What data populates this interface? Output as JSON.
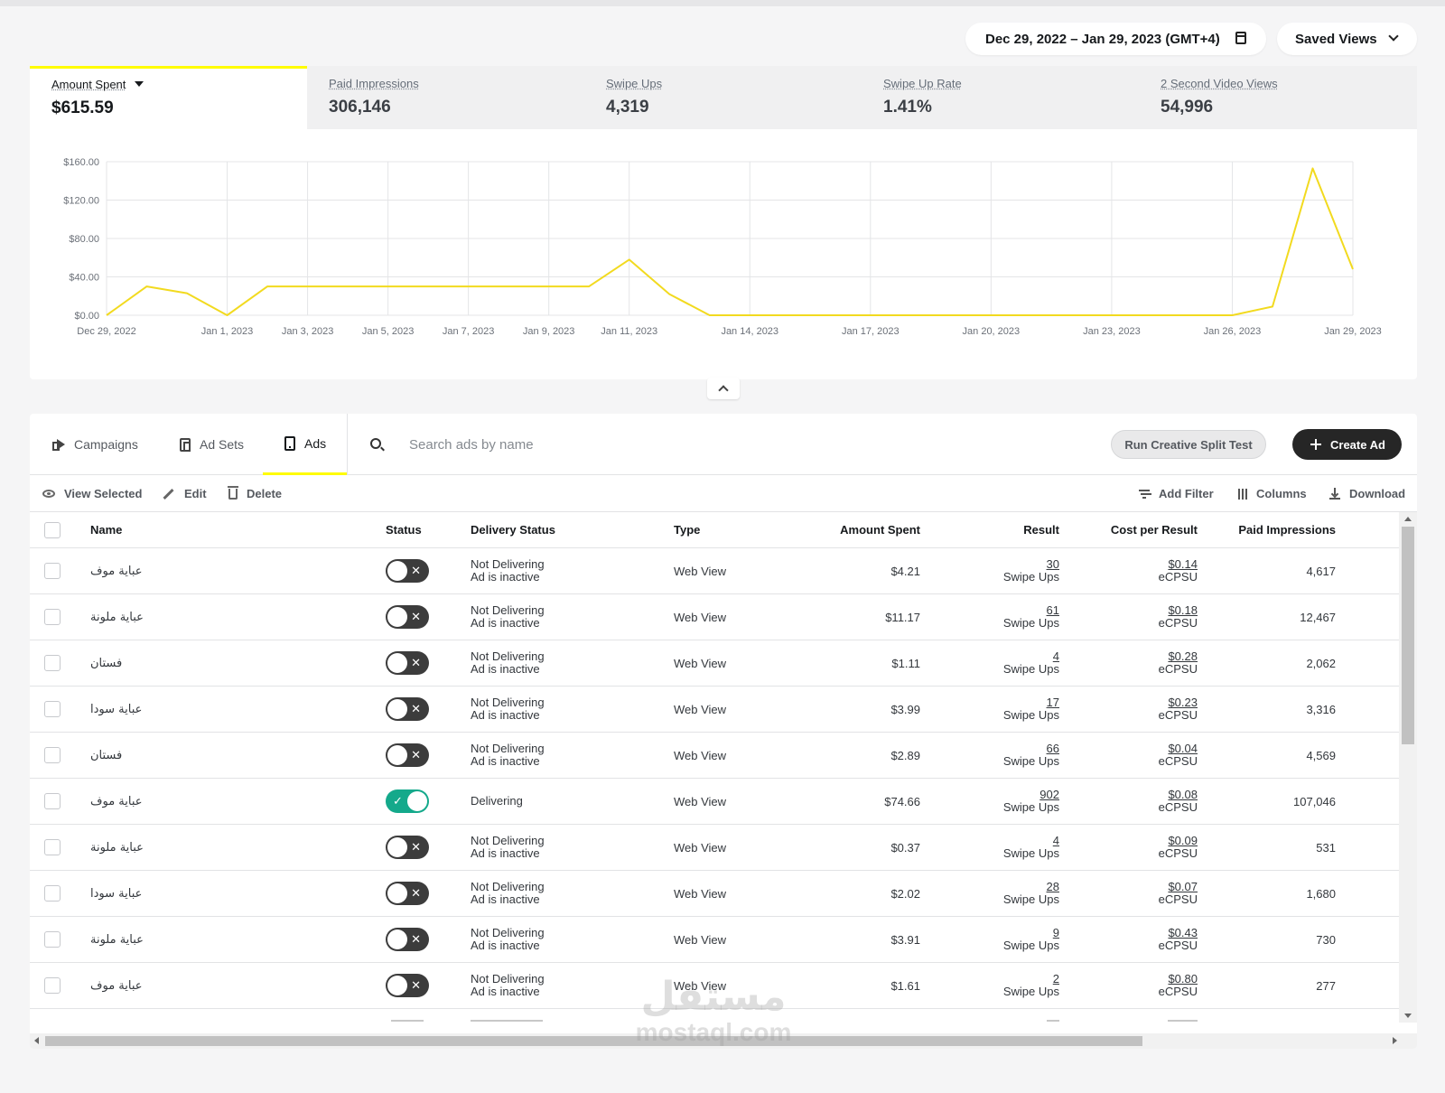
{
  "header": {
    "date_range": "Dec 29, 2022 – Jan 29, 2023 (GMT+4)",
    "saved_views": "Saved Views"
  },
  "metrics": [
    {
      "label": "Amount Spent",
      "value": "$615.59",
      "active": true
    },
    {
      "label": "Paid Impressions",
      "value": "306,146",
      "active": false
    },
    {
      "label": "Swipe Ups",
      "value": "4,319",
      "active": false
    },
    {
      "label": "Swipe Up Rate",
      "value": "1.41%",
      "active": false
    },
    {
      "label": "2 Second Video Views",
      "value": "54,996",
      "active": false
    }
  ],
  "chart_data": {
    "type": "line",
    "series": [
      {
        "values": [
          0,
          30,
          23,
          0,
          30,
          30,
          30,
          30,
          30,
          30,
          30,
          30,
          30,
          58,
          22,
          0,
          0,
          0,
          0,
          0,
          0,
          0,
          0,
          0,
          0,
          0,
          0,
          0,
          0,
          9,
          153,
          48
        ],
        "color": "#f2da1f"
      }
    ],
    "x": [
      "2022-12-29",
      "2022-12-30",
      "2022-12-31",
      "2023-01-01",
      "2023-01-02",
      "2023-01-03",
      "2023-01-04",
      "2023-01-05",
      "2023-01-06",
      "2023-01-07",
      "2023-01-08",
      "2023-01-09",
      "2023-01-10",
      "2023-01-11",
      "2023-01-12",
      "2023-01-13",
      "2023-01-14",
      "2023-01-15",
      "2023-01-16",
      "2023-01-17",
      "2023-01-18",
      "2023-01-19",
      "2023-01-20",
      "2023-01-21",
      "2023-01-22",
      "2023-01-23",
      "2023-01-24",
      "2023-01-25",
      "2023-01-26",
      "2023-01-27",
      "2023-01-28",
      "2023-01-29"
    ],
    "x_tick_labels": [
      {
        "date": "2022-12-29",
        "label": "Dec 29, 2022"
      },
      {
        "date": "2023-01-01",
        "label": "Jan 1, 2023"
      },
      {
        "date": "2023-01-03",
        "label": "Jan 3, 2023"
      },
      {
        "date": "2023-01-05",
        "label": "Jan 5, 2023"
      },
      {
        "date": "2023-01-07",
        "label": "Jan 7, 2023"
      },
      {
        "date": "2023-01-09",
        "label": "Jan 9, 2023"
      },
      {
        "date": "2023-01-11",
        "label": "Jan 11, 2023"
      },
      {
        "date": "2023-01-14",
        "label": "Jan 14, 2023"
      },
      {
        "date": "2023-01-17",
        "label": "Jan 17, 2023"
      },
      {
        "date": "2023-01-20",
        "label": "Jan 20, 2023"
      },
      {
        "date": "2023-01-23",
        "label": "Jan 23, 2023"
      },
      {
        "date": "2023-01-26",
        "label": "Jan 26, 2023"
      },
      {
        "date": "2023-01-29",
        "label": "Jan 29, 2023"
      }
    ],
    "y_ticks": [
      0,
      40,
      80,
      120,
      160
    ],
    "y_tick_labels": [
      "$0.00",
      "$40.00",
      "$80.00",
      "$120.00",
      "$160.00"
    ],
    "ylim": [
      0,
      160
    ],
    "grid": true
  },
  "tabs": [
    {
      "label": "Campaigns",
      "icon": "megaphone-icon",
      "active": false
    },
    {
      "label": "Ad Sets",
      "icon": "adsets-icon",
      "active": false
    },
    {
      "label": "Ads",
      "icon": "ad-icon",
      "active": true
    }
  ],
  "search": {
    "placeholder": "Search ads by name",
    "value": ""
  },
  "buttons": {
    "split_test": "Run Creative Split Test",
    "create_ad": "Create Ad"
  },
  "actions": {
    "view_selected": "View Selected",
    "edit": "Edit",
    "delete": "Delete",
    "add_filter": "Add Filter",
    "columns": "Columns",
    "download": "Download"
  },
  "table": {
    "columns": [
      "Name",
      "Status",
      "Delivery Status",
      "Type",
      "Amount Spent",
      "Result",
      "Cost per Result",
      "Paid Impressions"
    ],
    "result_unit": "Swipe Ups",
    "cost_unit": "eCPSU",
    "rows": [
      {
        "name": "عباية موف",
        "active": false,
        "delivery": "Not Delivering",
        "delivery_sub": "Ad is inactive",
        "type": "Web View",
        "spent": "$4.21",
        "result": "30",
        "cost": "$0.14",
        "impressions": "4,617"
      },
      {
        "name": "عباية ملونة",
        "active": false,
        "delivery": "Not Delivering",
        "delivery_sub": "Ad is inactive",
        "type": "Web View",
        "spent": "$11.17",
        "result": "61",
        "cost": "$0.18",
        "impressions": "12,467"
      },
      {
        "name": "فستان",
        "active": false,
        "delivery": "Not Delivering",
        "delivery_sub": "Ad is inactive",
        "type": "Web View",
        "spent": "$1.11",
        "result": "4",
        "cost": "$0.28",
        "impressions": "2,062"
      },
      {
        "name": "عباية سودا",
        "active": false,
        "delivery": "Not Delivering",
        "delivery_sub": "Ad is inactive",
        "type": "Web View",
        "spent": "$3.99",
        "result": "17",
        "cost": "$0.23",
        "impressions": "3,316"
      },
      {
        "name": "فستان",
        "active": false,
        "delivery": "Not Delivering",
        "delivery_sub": "Ad is inactive",
        "type": "Web View",
        "spent": "$2.89",
        "result": "66",
        "cost": "$0.04",
        "impressions": "4,569"
      },
      {
        "name": "عباية موف",
        "active": true,
        "delivery": "Delivering",
        "delivery_sub": "",
        "type": "Web View",
        "spent": "$74.66",
        "result": "902",
        "cost": "$0.08",
        "impressions": "107,046"
      },
      {
        "name": "عباية ملونة",
        "active": false,
        "delivery": "Not Delivering",
        "delivery_sub": "Ad is inactive",
        "type": "Web View",
        "spent": "$0.37",
        "result": "4",
        "cost": "$0.09",
        "impressions": "531"
      },
      {
        "name": "عباية سودا",
        "active": false,
        "delivery": "Not Delivering",
        "delivery_sub": "Ad is inactive",
        "type": "Web View",
        "spent": "$2.02",
        "result": "28",
        "cost": "$0.07",
        "impressions": "1,680"
      },
      {
        "name": "عباية ملونة",
        "active": false,
        "delivery": "Not Delivering",
        "delivery_sub": "Ad is inactive",
        "type": "Web View",
        "spent": "$3.91",
        "result": "9",
        "cost": "$0.43",
        "impressions": "730"
      },
      {
        "name": "عباية موف",
        "active": false,
        "delivery": "Not Delivering",
        "delivery_sub": "Ad is inactive",
        "type": "Web View",
        "spent": "$1.61",
        "result": "2",
        "cost": "$0.80",
        "impressions": "277"
      }
    ]
  },
  "watermark": {
    "arabic": "مستقل",
    "latin": "mostaql.com"
  },
  "colors": {
    "accent": "#fffc00",
    "line": "#f2da1f",
    "toggle_on": "#14a98b",
    "toggle_off": "#3c3c3c",
    "primary_button": "#262626"
  }
}
